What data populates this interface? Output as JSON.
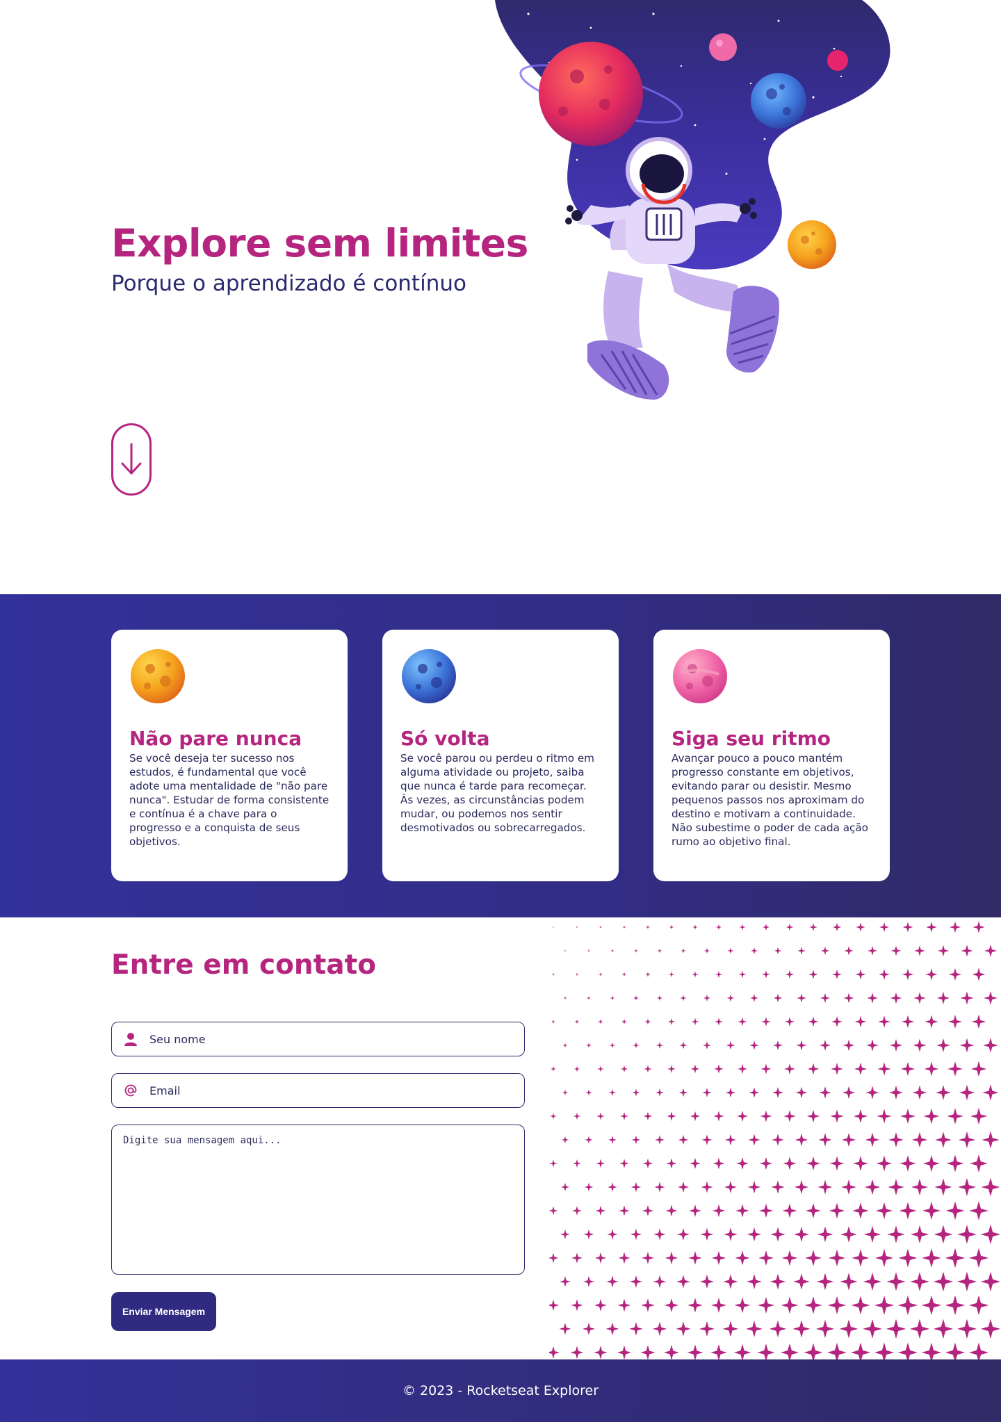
{
  "hero": {
    "title": "Explore sem limites",
    "subtitle": "Porque o aprendizado é contínuo",
    "scroll_icon": "arrow-down-icon",
    "illustration": "astronaut-in-space-illustration"
  },
  "cards": [
    {
      "icon": "orange-planet-icon",
      "title": "Não pare nunca",
      "text": "Se você deseja ter sucesso nos estudos, é fundamental que você adote uma mentalidade de \"não pare nunca\". Estudar de forma consistente e contínua é a chave para o progresso e a conquista de seus objetivos."
    },
    {
      "icon": "blue-planet-icon",
      "title": "Só volta",
      "text": "Se você parou ou perdeu o ritmo em alguma atividade ou projeto, saiba que nunca é tarde para recomeçar. Às vezes, as circunstâncias podem mudar, ou podemos nos sentir desmotivados ou sobrecarregados."
    },
    {
      "icon": "pink-planet-icon",
      "title": "Siga seu ritmo",
      "text": "Avançar pouco a pouco mantém progresso constante em objetivos, evitando parar ou desistir. Mesmo pequenos passos nos aproximam do destino e motivam a continuidade. Não subestime o poder de cada ação rumo ao objetivo final."
    }
  ],
  "contact": {
    "title": "Entre em contato",
    "name_placeholder": "Seu nome",
    "name_icon": "user-icon",
    "email_placeholder": "Email",
    "email_icon": "at-sign-icon",
    "message_placeholder": "Digite sua mensagem aqui...",
    "submit_label": "Enviar Mensagem",
    "decoration": "sparkle-stars-pattern"
  },
  "footer": {
    "text": "© 2023 - Rocketseat Explorer"
  },
  "colors": {
    "accent": "#b5257f",
    "navy": "#2f2b80",
    "text": "#2b2a5c"
  }
}
